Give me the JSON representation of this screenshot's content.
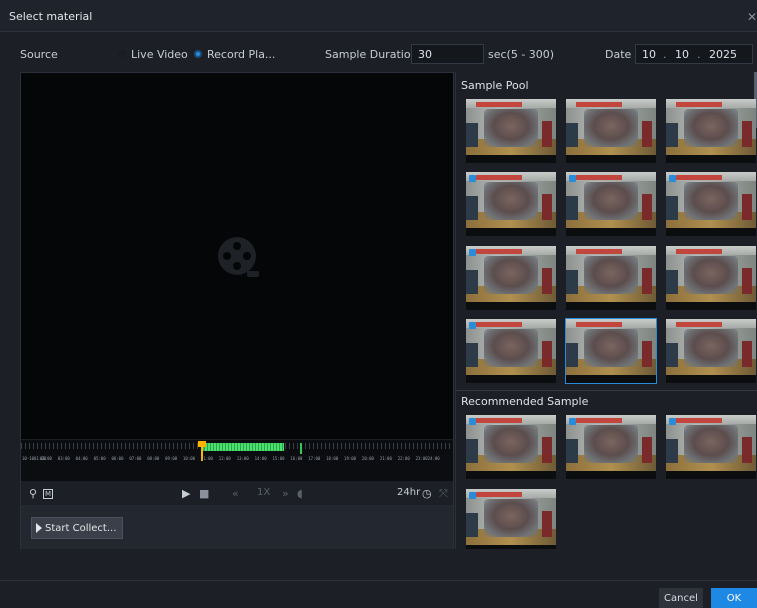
{
  "window": {
    "title": "Select material"
  },
  "source": {
    "label": "Source",
    "options": [
      {
        "label": "Live Video",
        "selected": false
      },
      {
        "label": "Record Pla...",
        "selected": true
      }
    ],
    "sample_duration_label": "Sample Duration",
    "sample_duration_value": "30",
    "sample_duration_hint": "sec(5 - 300)",
    "date_label": "Date",
    "date": {
      "day": "10",
      "month": "10",
      "year": "2025",
      "sep": "."
    }
  },
  "timeline": {
    "hours": [
      "10-1001:00",
      "02:00",
      "03:00",
      "04:00",
      "05:00",
      "06:00",
      "07:00",
      "08:00",
      "09:00",
      "10:00",
      "11:00",
      "12:00",
      "13:00",
      "14:00",
      "15:00",
      "16:00",
      "17:00",
      "18:00",
      "19:00",
      "20:00",
      "21:00",
      "22:00",
      "23:0024:00"
    ],
    "time_format": "24hr"
  },
  "controls": {
    "speed": "1X",
    "icons": [
      "smart-search-icon",
      "motion-icon",
      "play-icon",
      "stop-icon",
      "rewind-icon",
      "fast-forward-icon",
      "volume-icon",
      "clock-icon",
      "fullscreen-icon"
    ]
  },
  "collect": {
    "button_label": "Start Collect..."
  },
  "sample_pool": {
    "title": "Sample Pool",
    "thumbs": [
      {
        "checked": false,
        "selected": false
      },
      {
        "checked": false,
        "selected": false
      },
      {
        "checked": false,
        "selected": false
      },
      {
        "checked": true,
        "selected": false
      },
      {
        "checked": true,
        "selected": false
      },
      {
        "checked": true,
        "selected": false
      },
      {
        "checked": true,
        "selected": false
      },
      {
        "checked": false,
        "selected": false
      },
      {
        "checked": false,
        "selected": false
      },
      {
        "checked": true,
        "selected": false
      },
      {
        "checked": false,
        "selected": true
      },
      {
        "checked": false,
        "selected": false
      }
    ]
  },
  "recommended": {
    "title": "Recommended Sample",
    "thumbs": [
      {
        "checked": true
      },
      {
        "checked": true
      },
      {
        "checked": true
      },
      {
        "checked": true
      }
    ]
  },
  "footer": {
    "cancel_label": "Cancel",
    "ok_label": "OK"
  },
  "colors": {
    "accent": "#1e88e5",
    "record_green": "#37c85a",
    "cursor": "#ffb400"
  }
}
